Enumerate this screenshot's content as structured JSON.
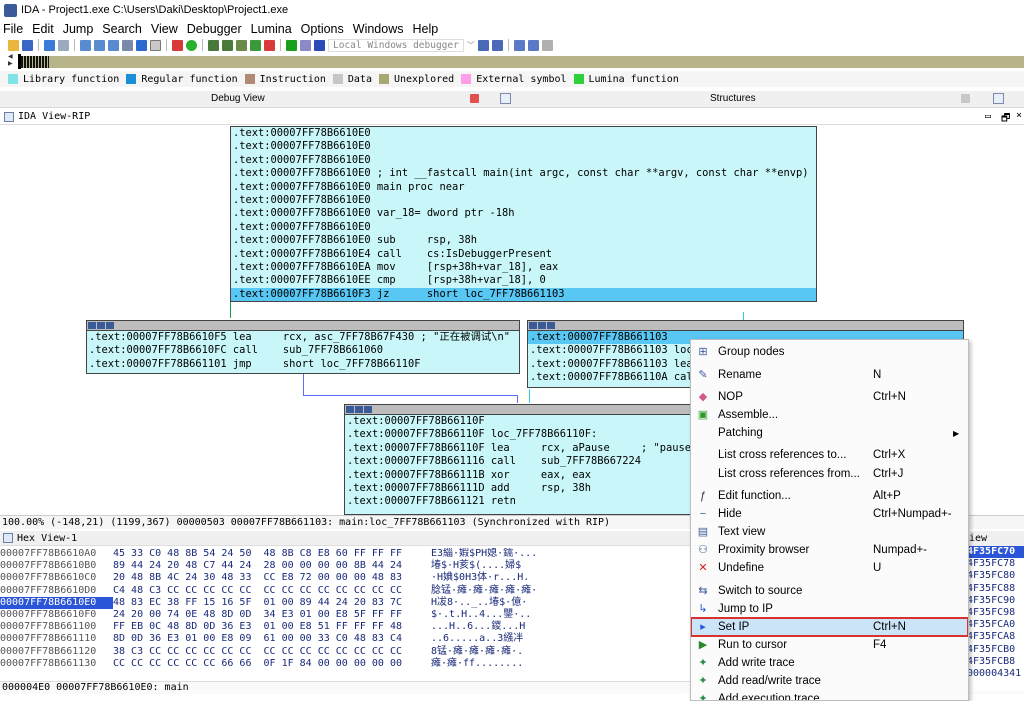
{
  "window": {
    "title": "IDA - Project1.exe C:\\Users\\Daki\\Desktop\\Project1.exe"
  },
  "menu": [
    "File",
    "Edit",
    "Jump",
    "Search",
    "View",
    "Debugger",
    "Lumina",
    "Options",
    "Windows",
    "Help"
  ],
  "toolbar": {
    "debugger_select": "Local Windows debugger"
  },
  "legend": [
    {
      "label": "Library function",
      "color": "#7fe3e8"
    },
    {
      "label": "Regular function",
      "color": "#1a8fd8"
    },
    {
      "label": "Instruction",
      "color": "#b08a74"
    },
    {
      "label": "Data",
      "color": "#c6c6c6"
    },
    {
      "label": "Unexplored",
      "color": "#a8a870"
    },
    {
      "label": "External symbol",
      "color": "#ff9ee8"
    },
    {
      "label": "Lumina function",
      "color": "#2ed13a"
    }
  ],
  "tabs": {
    "debug_view": "Debug View",
    "structures": "Structures"
  },
  "ida_view": {
    "title": "IDA View-RIP"
  },
  "main_node": [
    ".text:00007FF78B6610E0",
    ".text:00007FF78B6610E0",
    ".text:00007FF78B6610E0",
    ".text:00007FF78B6610E0 ; int __fastcall main(int argc, const char **argv, const char **envp)",
    ".text:00007FF78B6610E0 main proc near",
    ".text:00007FF78B6610E0",
    ".text:00007FF78B6610E0 var_18= dword ptr -18h",
    ".text:00007FF78B6610E0",
    ".text:00007FF78B6610E0 sub     rsp, 38h",
    ".text:00007FF78B6610E4 call    cs:IsDebuggerPresent",
    ".text:00007FF78B6610EA mov     [rsp+38h+var_18], eax",
    ".text:00007FF78B6610EE cmp     [rsp+38h+var_18], 0",
    ".text:00007FF78B6610F3 jz      short loc_7FF78B661103"
  ],
  "left_node": [
    ".text:00007FF78B6610F5 lea     rcx, asc_7FF78B67F430 ; \"正在被调试\\n\"",
    ".text:00007FF78B6610FC call    sub_7FF78B661060",
    ".text:00007FF78B661101 jmp     short loc_7FF78B66110F"
  ],
  "right_node": [
    ".text:00007FF78B661103",
    ".text:00007FF78B661103 loc",
    ".text:00007FF78B661103 lea",
    ".text:00007FF78B66110A cal"
  ],
  "bottom_node": [
    ".text:00007FF78B66110F",
    ".text:00007FF78B66110F loc_7FF78B66110F:",
    ".text:00007FF78B66110F lea     rcx, aPause     ; \"pause",
    ".text:00007FF78B661116 call    sub_7FF78B667224",
    ".text:00007FF78B66111B xor     eax, eax",
    ".text:00007FF78B66111D add     rsp, 38h",
    ".text:00007FF78B661121 retn"
  ],
  "status_bar": "100.00% (-148,21) (1199,367) 00000503 00007FF78B661103: main:loc_7FF78B661103 (Synchronized with RIP)",
  "hex_view": {
    "title": "Hex View-1",
    "rows": [
      {
        "addr": "00007FF78B6610A0",
        "bytes": "45 33 C0 48 8B 54 24 50  48 8B C8 E8 60 FF FF FF",
        "ascii": "E3緇·婽$PH媳·鑐·..."
      },
      {
        "addr": "00007FF78B6610B0",
        "bytes": "89 44 24 20 48 C7 44 24  28 00 00 00 00 8B 44 24",
        "ascii": "堾$·H荄$(....婦$"
      },
      {
        "addr": "00007FF78B6610C0",
        "bytes": "20 48 8B 4C 24 30 48 33  CC E8 72 00 00 00 48 83",
        "ascii": "·H婰$0H3体·r...H."
      },
      {
        "addr": "00007FF78B6610D0",
        "bytes": "C4 48 C3 CC CC CC CC CC  CC CC CC CC CC CC CC CC",
        "ascii": "腍锰·瘫·瘫·瘫·瘫·瘫·"
      },
      {
        "addr": "00007FF78B6610E0",
        "bytes": "48 83 EC 38 FF 15 16 5F  01 00 89 44 24 20 83 7C",
        "ascii": "H冹8·.._..堾$·億·",
        "current": true
      },
      {
        "addr": "00007FF78B6610F0",
        "bytes": "24 20 00 74 0E 48 8D 0D  34 E3 01 00 E8 5F FF FF",
        "ascii": "$·.t.H..4...鑍·.."
      },
      {
        "addr": "00007FF78B661100",
        "bytes": "FF EB 0C 48 8D 0D 36 E3  01 00 E8 51 FF FF FF 48",
        "ascii": "...H..6...鑁...H"
      },
      {
        "addr": "00007FF78B661110",
        "bytes": "8D 0D 36 E3 01 00 E8 09  61 00 00 33 C0 48 83 C4",
        "ascii": "..6.....a..3繦冸"
      },
      {
        "addr": "00007FF78B661120",
        "bytes": "38 C3 CC CC CC CC CC CC  CC CC CC CC CC CC CC CC",
        "ascii": "8锰·瘫·瘫·瘫·瘫·."
      },
      {
        "addr": "00007FF78B661130",
        "bytes": "CC CC CC CC CC CC 66 66  0F 1F 84 00 00 00 00 00",
        "ascii": "瘫·瘫·ff........"
      }
    ],
    "status": "000004E0 00007FF78B6610E0: main"
  },
  "stack_view": {
    "title": "iew",
    "rows": [
      "4F35FC70",
      "4F35FC78",
      "4F35FC80",
      "4F35FC88",
      "4F35FC90",
      "4F35FC98",
      "4F35FCA0",
      "4F35FCA8",
      "4F35FCB0",
      "4F35FCB8",
      "000004341"
    ]
  },
  "context_menu": {
    "items": [
      {
        "label": "Group nodes",
        "shortcut": "",
        "icon": "group-icon"
      },
      {
        "label": "Rename",
        "shortcut": "N",
        "icon": "rename-icon"
      },
      {
        "label": "NOP",
        "shortcut": "Ctrl+N",
        "icon": "eraser-icon"
      },
      {
        "label": "Assemble...",
        "shortcut": "",
        "icon": "chip-icon"
      },
      {
        "label": "Patching",
        "shortcut": "",
        "icon": "",
        "submenu": true
      },
      {
        "label": "List cross references to...",
        "shortcut": "Ctrl+X",
        "icon": ""
      },
      {
        "label": "List cross references from...",
        "shortcut": "Ctrl+J",
        "icon": ""
      },
      {
        "label": "Edit function...",
        "shortcut": "Alt+P",
        "icon": "function-icon"
      },
      {
        "label": "Hide",
        "shortcut": "Ctrl+Numpad+-",
        "icon": "hide-icon"
      },
      {
        "label": "Text view",
        "shortcut": "",
        "icon": "text-view-icon"
      },
      {
        "label": "Proximity browser",
        "shortcut": "Numpad+-",
        "icon": "proximity-icon"
      },
      {
        "label": "Undefine",
        "shortcut": "U",
        "icon": "undefine-icon"
      },
      {
        "label": "Switch to source",
        "shortcut": "",
        "icon": "source-icon"
      },
      {
        "label": "Jump to IP",
        "shortcut": "",
        "icon": "jump-ip-icon"
      },
      {
        "label": "Set IP",
        "shortcut": "Ctrl+N",
        "icon": "set-ip-icon",
        "highlighted": true
      },
      {
        "label": "Run to cursor",
        "shortcut": "F4",
        "icon": "run-cursor-icon"
      },
      {
        "label": "Add write trace",
        "shortcut": "",
        "icon": "trace-icon"
      },
      {
        "label": "Add read/write trace",
        "shortcut": "",
        "icon": "trace-icon"
      },
      {
        "label": "Add execution trace",
        "shortcut": "",
        "icon": "trace-icon"
      }
    ]
  }
}
